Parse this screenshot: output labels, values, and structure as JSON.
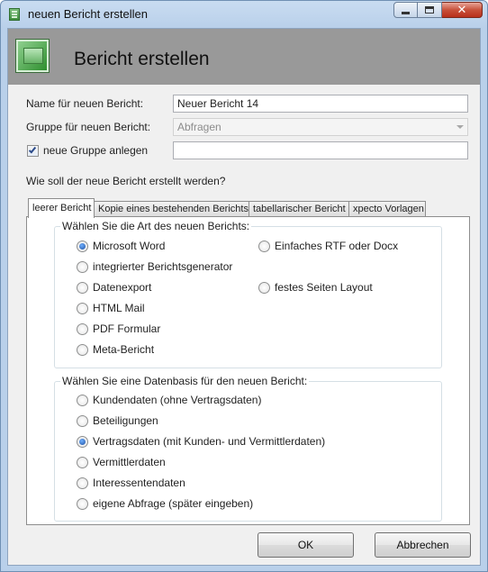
{
  "window": {
    "title": "neuen Bericht erstellen"
  },
  "header": {
    "title": "Bericht erstellen"
  },
  "form": {
    "name_label": "Name für neuen Bericht:",
    "name_value": "Neuer Bericht 14",
    "group_label": "Gruppe für neuen Bericht:",
    "group_value": "Abfragen",
    "new_group_label": "neue Gruppe anlegen",
    "new_group_checked": true,
    "new_group_value": "",
    "question": "Wie soll der neue Bericht erstellt werden?"
  },
  "tabs": [
    {
      "label": "leerer Bericht",
      "active": true
    },
    {
      "label": "Kopie eines bestehenden Berichts",
      "active": false
    },
    {
      "label": "tabellarischer Bericht",
      "active": false
    },
    {
      "label": "xpecto Vorlagen",
      "active": false
    }
  ],
  "art_group": {
    "legend": "Wählen Sie die Art des neuen Berichts:",
    "left_options": [
      {
        "label": "Microsoft Word",
        "checked": true
      },
      {
        "label": "integrierter Berichtsgenerator",
        "checked": false
      },
      {
        "label": "Datenexport",
        "checked": false
      },
      {
        "label": "HTML Mail",
        "checked": false
      },
      {
        "label": "PDF Formular",
        "checked": false
      },
      {
        "label": "Meta-Bericht",
        "checked": false
      }
    ],
    "right_options": [
      {
        "label": "Einfaches RTF oder Docx",
        "checked": false
      },
      {
        "label": "festes Seiten Layout",
        "checked": false
      }
    ]
  },
  "data_group": {
    "legend": "Wählen Sie eine Datenbasis für den neuen Bericht:",
    "options": [
      {
        "label": "Kundendaten (ohne Vertragsdaten)",
        "checked": false
      },
      {
        "label": "Beteiligungen",
        "checked": false
      },
      {
        "label": "Vertragsdaten (mit Kunden- und Vermittlerdaten)",
        "checked": true
      },
      {
        "label": "Vermittlerdaten",
        "checked": false
      },
      {
        "label": "Interessentendaten",
        "checked": false
      },
      {
        "label": "eigene Abfrage (später eingeben)",
        "checked": false
      }
    ]
  },
  "buttons": {
    "ok": "OK",
    "cancel": "Abbrechen"
  },
  "icons": {
    "title": "report-app-icon",
    "header": "report-header-icon"
  }
}
